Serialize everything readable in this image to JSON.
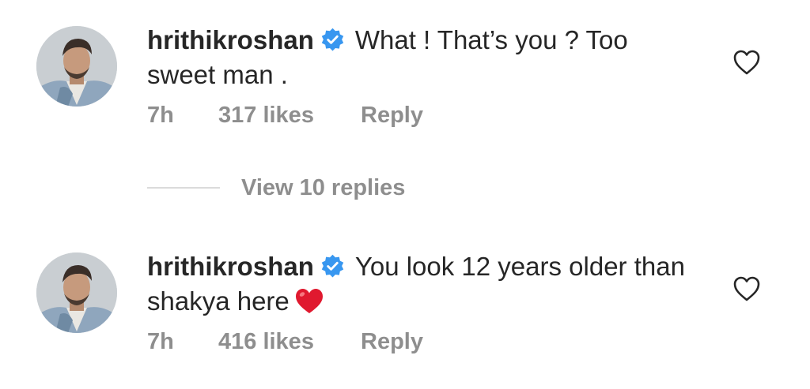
{
  "colors": {
    "text_primary": "#262626",
    "text_secondary": "#8e8e8e",
    "verified_blue": "#3897f0",
    "heart_red": "#e0192f",
    "divider": "#dbdbdb"
  },
  "comments": [
    {
      "avatar_icon": "profile-photo",
      "username": "hrithikroshan",
      "verified_icon": "verified-badge-icon",
      "text": "What ! That’s you ? Too sweet man .",
      "emoji": "",
      "time": "7h",
      "likes": "317 likes",
      "reply_label": "Reply",
      "like_icon": "heart-outline-icon"
    },
    {
      "avatar_icon": "profile-photo",
      "username": "hrithikroshan",
      "verified_icon": "verified-badge-icon",
      "text": "You look 12 years older than shakya here",
      "emoji": "red-heart-emoji",
      "time": "7h",
      "likes": "416 likes",
      "reply_label": "Reply",
      "like_icon": "heart-outline-icon"
    }
  ],
  "view_replies": {
    "label": "View 10 replies"
  }
}
